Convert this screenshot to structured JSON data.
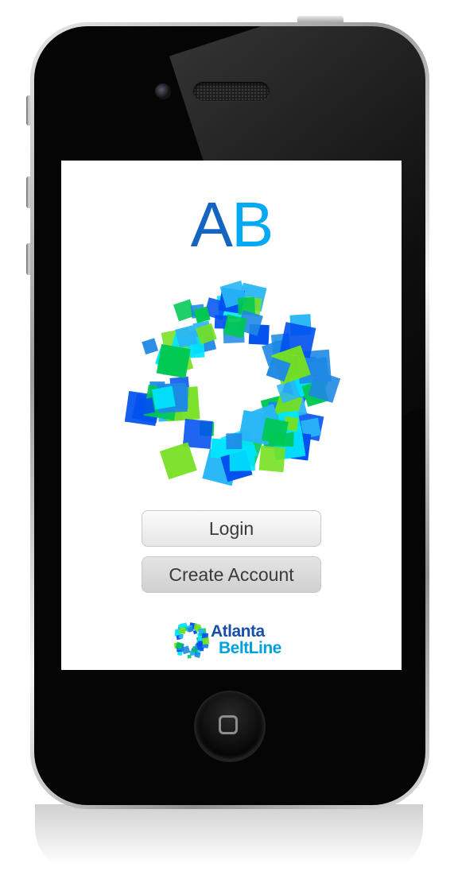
{
  "app": {
    "title_a": "A",
    "title_b": "B"
  },
  "buttons": {
    "login": "Login",
    "create_account": "Create Account"
  },
  "footer": {
    "brand_line1": "Atlanta",
    "brand_line2": "BeltLine"
  },
  "colors": {
    "title_a": "#1565c0",
    "title_b": "#03a9f4",
    "logo_palette": [
      "#00e5ff",
      "#1e88e5",
      "#0050ef",
      "#76e020",
      "#00c853",
      "#29b6f6"
    ]
  },
  "icons": {
    "ring_logo": "beltline-ring-logo",
    "footer_logo": "beltline-small-ring-logo",
    "home": "home-button-square-icon"
  }
}
